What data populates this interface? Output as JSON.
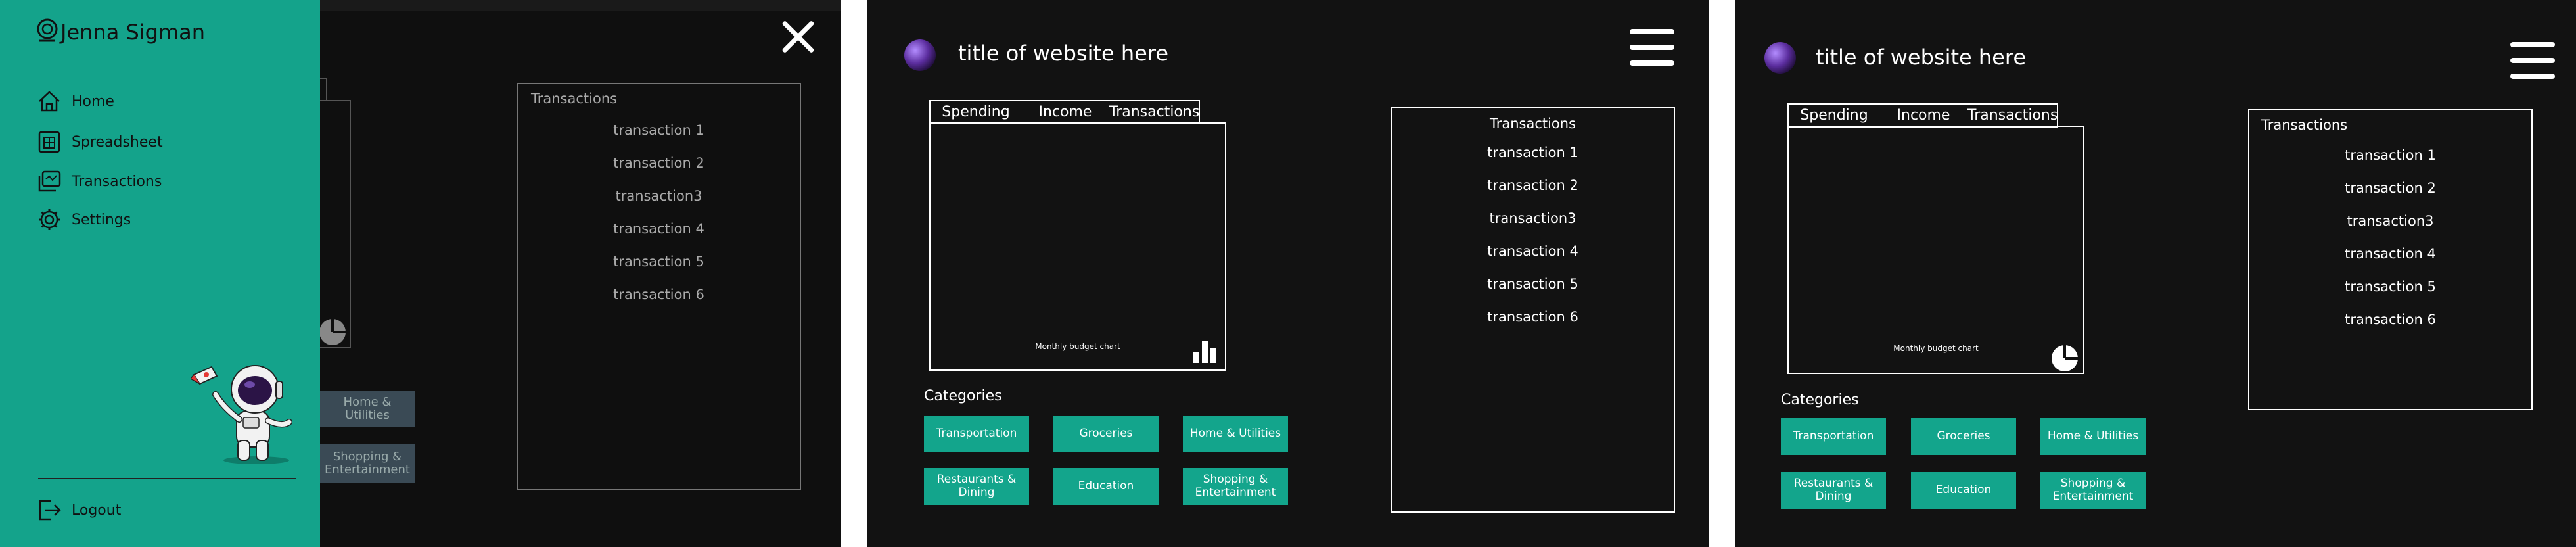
{
  "frame1": {
    "drawer": {
      "user_name": "Jenna Sigman",
      "nav": [
        {
          "label": "Home",
          "icon": "home-icon"
        },
        {
          "label": "Spreadsheet",
          "icon": "spreadsheet-icon"
        },
        {
          "label": "Transactions",
          "icon": "transactions-icon"
        },
        {
          "label": "Settings",
          "icon": "gear-icon"
        }
      ],
      "logout_label": "Logout"
    },
    "transactions_title": "Transactions",
    "transactions": [
      "transaction 1",
      "transaction 2",
      "transaction3",
      "transaction 4",
      "transaction 5",
      "transaction 6"
    ],
    "categories_partial": [
      "Home & Utilities",
      "Shopping & Entertainment"
    ]
  },
  "frame2": {
    "site_title": "title of website here",
    "tabs": [
      "Spending",
      "Income",
      "Transactions"
    ],
    "chart_label": "Monthly budget chart",
    "chart_icon": "bar-chart-icon",
    "categories_label": "Categories",
    "categories": [
      "Transportation",
      "Groceries",
      "Home & Utilities",
      "Restaurants & Dining",
      "Education",
      "Shopping & Entertainment"
    ],
    "transactions_title": "Transactions",
    "transactions": [
      "transaction 1",
      "transaction 2",
      "transaction3",
      "transaction 4",
      "transaction 5",
      "transaction 6"
    ]
  },
  "frame3": {
    "site_title": "title of website here",
    "tabs": [
      "Spending",
      "Income",
      "Transactions"
    ],
    "chart_label": "Monthly budget chart",
    "chart_icon": "pie-chart-icon",
    "categories_label": "Categories",
    "categories": [
      "Transportation",
      "Groceries",
      "Home & Utilities",
      "Restaurants & Dining",
      "Education",
      "Shopping & Entertainment"
    ],
    "transactions_title": "Transactions",
    "transactions": [
      "transaction 1",
      "transaction 2",
      "transaction3",
      "transaction 4",
      "transaction 5",
      "transaction 6"
    ]
  },
  "colors": {
    "background": "#121212",
    "accent": "#13a58c",
    "drawer": "#14a38b",
    "text": "#ffffff"
  }
}
